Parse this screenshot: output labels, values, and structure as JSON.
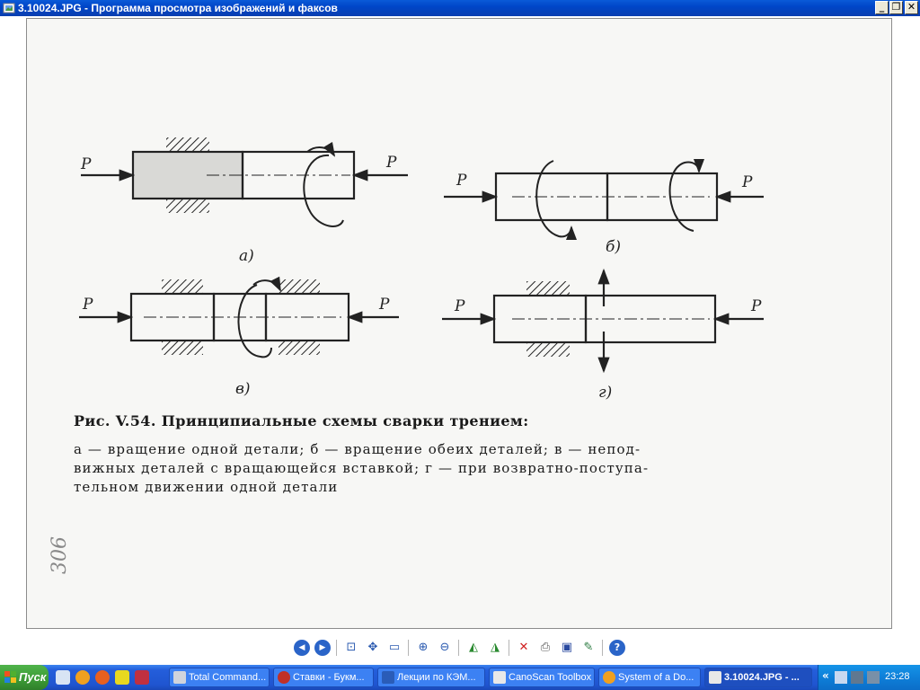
{
  "window": {
    "title": "3.10024.JPG - Программа просмотра изображений и факсов",
    "min_label": "_",
    "max_label": "❐",
    "close_label": "✕"
  },
  "figure": {
    "labels": [
      "а)",
      "б)",
      "в)",
      "г)"
    ],
    "force_label": "P",
    "caption_title": "Рис. V.54. Принципиальные схемы сварки трением:",
    "caption_lines": [
      "а — вращение одной детали;  б — вращение обеих деталей;  в — непод-",
      "вижных деталей с вращающейся вставкой;  г — при возвратно-поступа-",
      "тельном движении одной детали"
    ],
    "handwritten_note": "306"
  },
  "toolbar": {
    "buttons": [
      {
        "name": "previous-image-icon",
        "glyph": "◀"
      },
      {
        "name": "next-image-icon",
        "glyph": "▶"
      },
      {
        "name": "best-fit-icon",
        "glyph": "⊡"
      },
      {
        "name": "actual-size-icon",
        "glyph": "✥"
      },
      {
        "name": "slideshow-icon",
        "glyph": "▭"
      },
      {
        "name": "zoom-in-icon",
        "glyph": "⊕"
      },
      {
        "name": "zoom-out-icon",
        "glyph": "⊖"
      },
      {
        "name": "rotate-clockwise-icon",
        "glyph": "◭"
      },
      {
        "name": "rotate-counterclockwise-icon",
        "glyph": "◮"
      },
      {
        "name": "delete-icon",
        "glyph": "✕"
      },
      {
        "name": "print-icon",
        "glyph": "⎙"
      },
      {
        "name": "save-icon",
        "glyph": "▣"
      },
      {
        "name": "edit-icon",
        "glyph": "✎"
      },
      {
        "name": "help-icon",
        "glyph": "?"
      }
    ]
  },
  "taskbar": {
    "start_label": "Пуск",
    "tasks": [
      {
        "label": "Total Command...",
        "icon_color": "#d0d4dc"
      },
      {
        "label": "Ставки - Букм...",
        "icon_color": "#c03028"
      },
      {
        "label": "Лекции по КЭМ...",
        "icon_color": "#2a5cb8"
      },
      {
        "label": "CanoScan Toolbox",
        "icon_color": "#e8e8e8"
      },
      {
        "label": "System of a Do...",
        "icon_color": "#f0a020"
      },
      {
        "label": "3.10024.JPG - ...",
        "icon_color": "#e8e8e8"
      }
    ],
    "tray_chevron": "«",
    "clock": "23:28"
  },
  "colors": {
    "title_bar": "#0046c8",
    "taskbar": "#245edb",
    "start_button": "#3b9a35",
    "tray": "#0e7fd8"
  }
}
